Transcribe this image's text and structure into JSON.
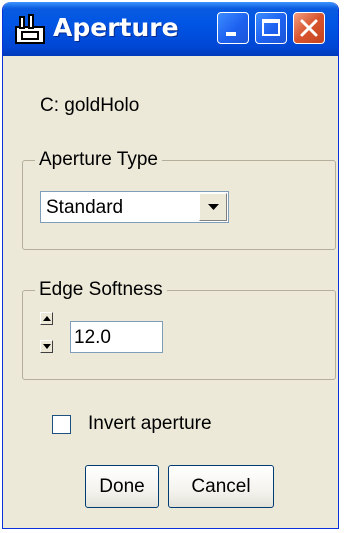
{
  "window": {
    "title": "Aperture",
    "icon": "aperture-app-icon",
    "controls": [
      "minimize-icon",
      "maximize-icon",
      "close-icon"
    ]
  },
  "label": "C: goldHolo",
  "aperture_type": {
    "group_label": "Aperture Type",
    "selected": "Standard"
  },
  "edge_softness": {
    "group_label": "Edge Softness",
    "value": "12.0"
  },
  "invert": {
    "label": "Invert aperture",
    "checked": false
  },
  "buttons": {
    "done": "Done",
    "cancel": "Cancel"
  }
}
